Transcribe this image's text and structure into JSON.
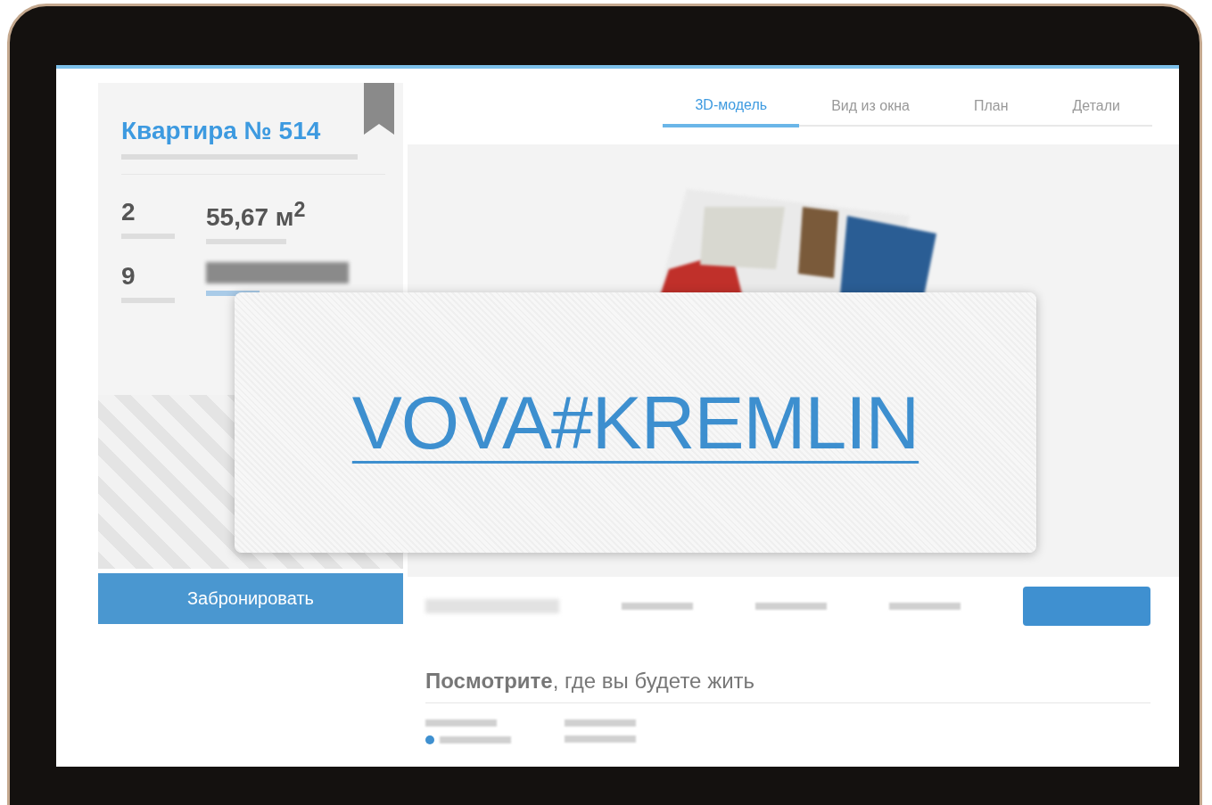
{
  "listing": {
    "title": "Квартира № 514",
    "rooms": "2",
    "area": "55,67 м$^{2}$",
    "floor": "9"
  },
  "tabs": [
    {
      "label": "3D-модель",
      "selected": true
    },
    {
      "label": "Вид из окна",
      "selected": false
    },
    {
      "label": "План",
      "selected": false
    },
    {
      "label": "Детали",
      "selected": false
    }
  ],
  "book_button": "Забронировать",
  "section_heading": "**Посмотрите**, где вы будете жить",
  "overlay": {
    "link": "VOVA#KREMLIN"
  }
}
